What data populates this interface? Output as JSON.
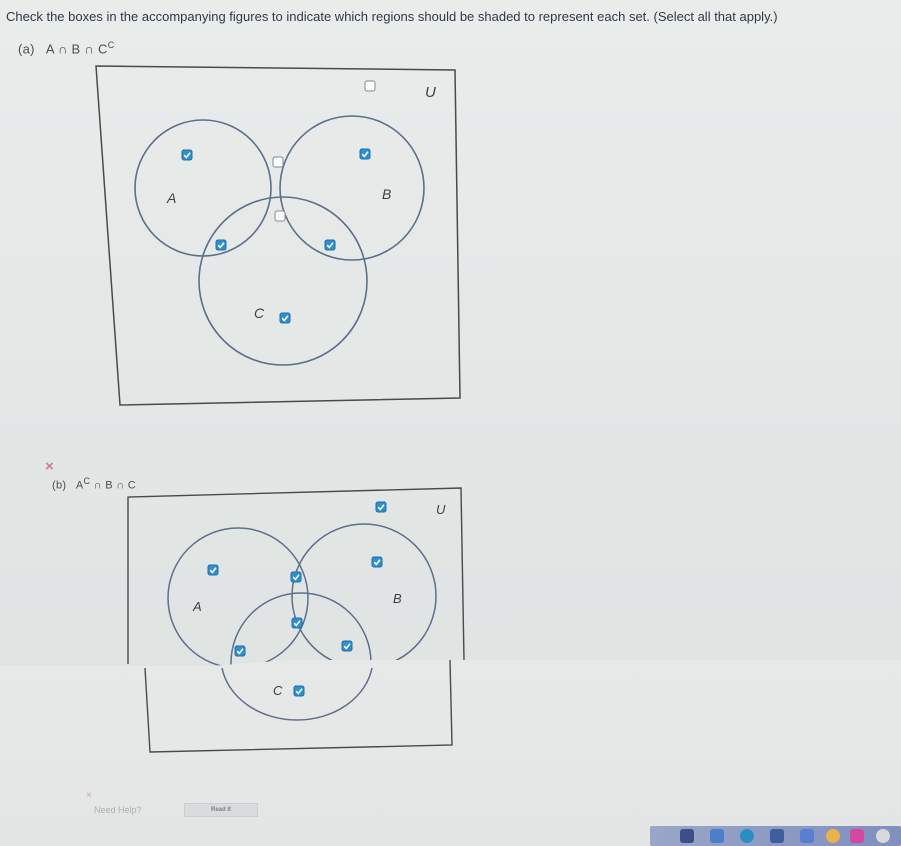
{
  "instructions": "Check the boxes in the accompanying figures to indicate which regions should be shaded to represent each set. (Select all that apply.)",
  "colors": {
    "checked": "#2f8fd0",
    "circle": "#5d6f8a",
    "frame": "#4a4a4a"
  },
  "part_a": {
    "label": "(a)",
    "expression": "A ∩ B ∩ C",
    "expression_sup": "C",
    "set_labels": {
      "A": "A",
      "B": "B",
      "C": "C",
      "U": "U"
    },
    "regions": {
      "outside": false,
      "a_only": true,
      "b_only": true,
      "ab_only": false,
      "abc": false,
      "ac_only": true,
      "bc_only": true,
      "c_only": true
    }
  },
  "part_b": {
    "label": "(b)",
    "expression_pre": "A",
    "expression_sup": "C",
    "expression_post": "∩ B ∩ C",
    "wrong_mark": "×",
    "set_labels": {
      "A": "A",
      "B": "B",
      "C": "C",
      "U": "U"
    },
    "regions": {
      "outside": true,
      "a_only": true,
      "b_only": true,
      "ab_only": true,
      "abc": true,
      "ac_only": true,
      "bc_only": true,
      "c_only": true
    }
  },
  "help": {
    "label": "Need Help?",
    "read_button": "Read It",
    "wrong_mark": "×"
  }
}
